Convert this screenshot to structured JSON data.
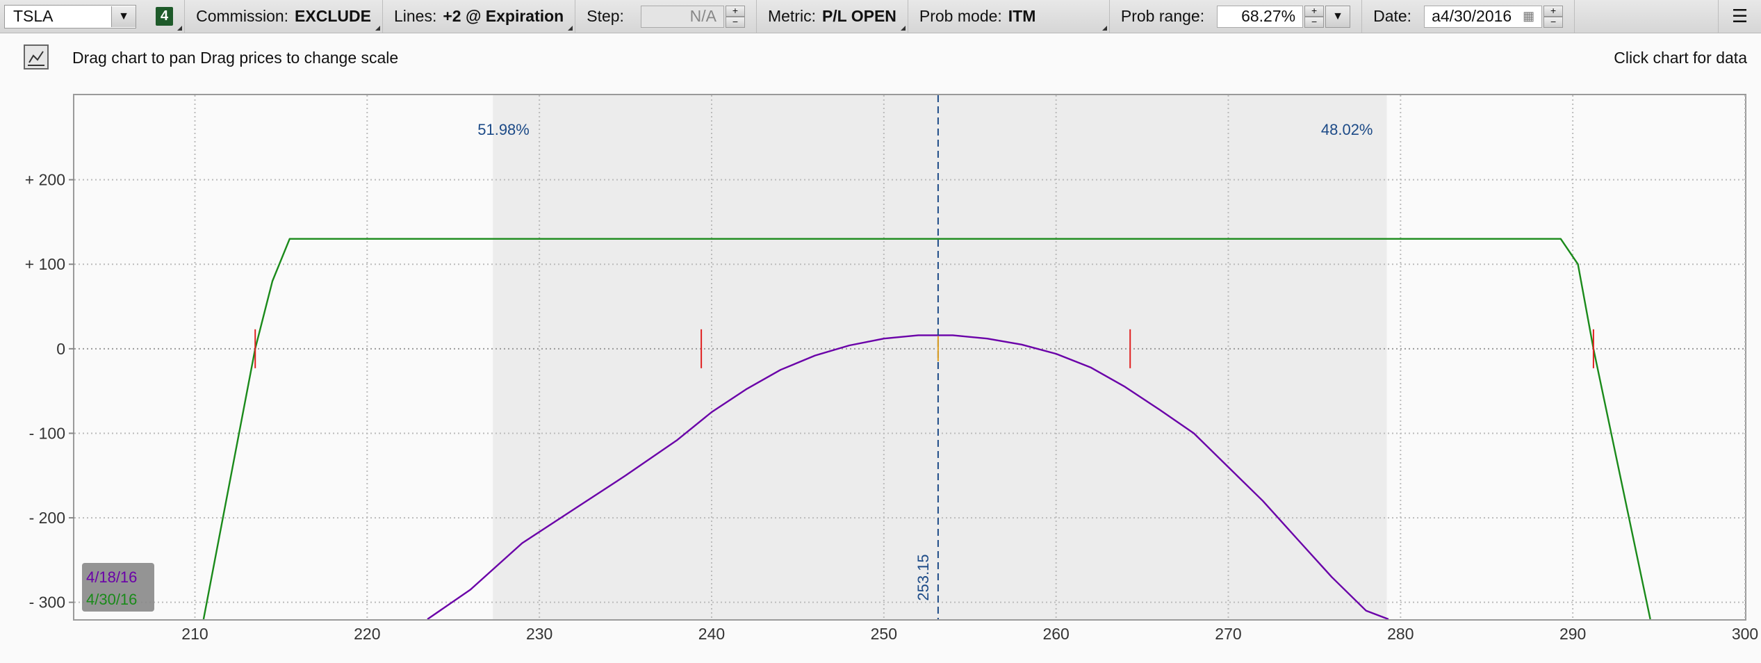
{
  "toolbar": {
    "symbol": "TSLA",
    "badge": "4",
    "commission_label": "Commission:",
    "commission_value": "EXCLUDE",
    "lines_label": "Lines:",
    "lines_value": "+2 @ Expiration",
    "step_label": "Step:",
    "step_value": "N/A",
    "metric_label": "Metric:",
    "metric_value": "P/L OPEN",
    "prob_mode_label": "Prob mode:",
    "prob_mode_value": "ITM",
    "prob_range_label": "Prob range:",
    "prob_range_value": "68.27%",
    "date_label": "Date:",
    "date_value": "а4/30/2016"
  },
  "header": {
    "instructions": "Drag chart to pan Drag prices to change scale",
    "right_hint": "Click chart for data"
  },
  "colors": {
    "series_0418": "#6a00a8",
    "series_0430": "#1a8a1a",
    "price_marker": "#1c4a87",
    "breakeven_marker": "#e02020",
    "prob_band": "#ececec",
    "plot_bg": "#fafafa"
  },
  "chart_data": {
    "type": "line",
    "xlim": [
      203,
      300
    ],
    "ylim": [
      -320,
      300
    ],
    "x_ticks": [
      210,
      220,
      230,
      240,
      250,
      260,
      270,
      280,
      290,
      300
    ],
    "x_tick_labels": [
      "210",
      "220",
      "230",
      "240",
      "250",
      "260",
      "270",
      "280",
      "290",
      "300"
    ],
    "y_ticks": [
      200,
      100,
      0,
      -100,
      -200,
      -300
    ],
    "y_tick_labels": [
      "+ 200",
      "+ 100",
      "0",
      "- 100",
      "- 200",
      "- 300"
    ],
    "grid": true,
    "current_price": 253.15,
    "current_price_label": "253.15",
    "prob_band": [
      227.3,
      279.2
    ],
    "prob_left_label": "51.98%",
    "prob_right_label": "48.02%",
    "breakevens": [
      213.5,
      239.4,
      264.3,
      291.2
    ],
    "series": [
      {
        "name": "4/18/16",
        "color": "#6a00a8",
        "points": [
          [
            223.5,
            -320
          ],
          [
            226,
            -285
          ],
          [
            229,
            -230
          ],
          [
            232,
            -190
          ],
          [
            235,
            -150
          ],
          [
            238,
            -108
          ],
          [
            240,
            -75
          ],
          [
            242,
            -48
          ],
          [
            244,
            -25
          ],
          [
            246,
            -8
          ],
          [
            248,
            4
          ],
          [
            250,
            12
          ],
          [
            252,
            16
          ],
          [
            254,
            16
          ],
          [
            256,
            12
          ],
          [
            258,
            5
          ],
          [
            260,
            -6
          ],
          [
            262,
            -22
          ],
          [
            264,
            -45
          ],
          [
            266,
            -72
          ],
          [
            268,
            -100
          ],
          [
            270,
            -140
          ],
          [
            272,
            -180
          ],
          [
            274,
            -225
          ],
          [
            276,
            -270
          ],
          [
            278,
            -310
          ],
          [
            279.3,
            -320
          ]
        ]
      },
      {
        "name": "4/30/16",
        "color": "#1a8a1a",
        "points": [
          [
            210.5,
            -320
          ],
          [
            213.5,
            0
          ],
          [
            214.5,
            80
          ],
          [
            215.5,
            130
          ],
          [
            289.3,
            130
          ],
          [
            290.3,
            100
          ],
          [
            291.2,
            0
          ],
          [
            294.5,
            -320
          ]
        ]
      }
    ]
  }
}
